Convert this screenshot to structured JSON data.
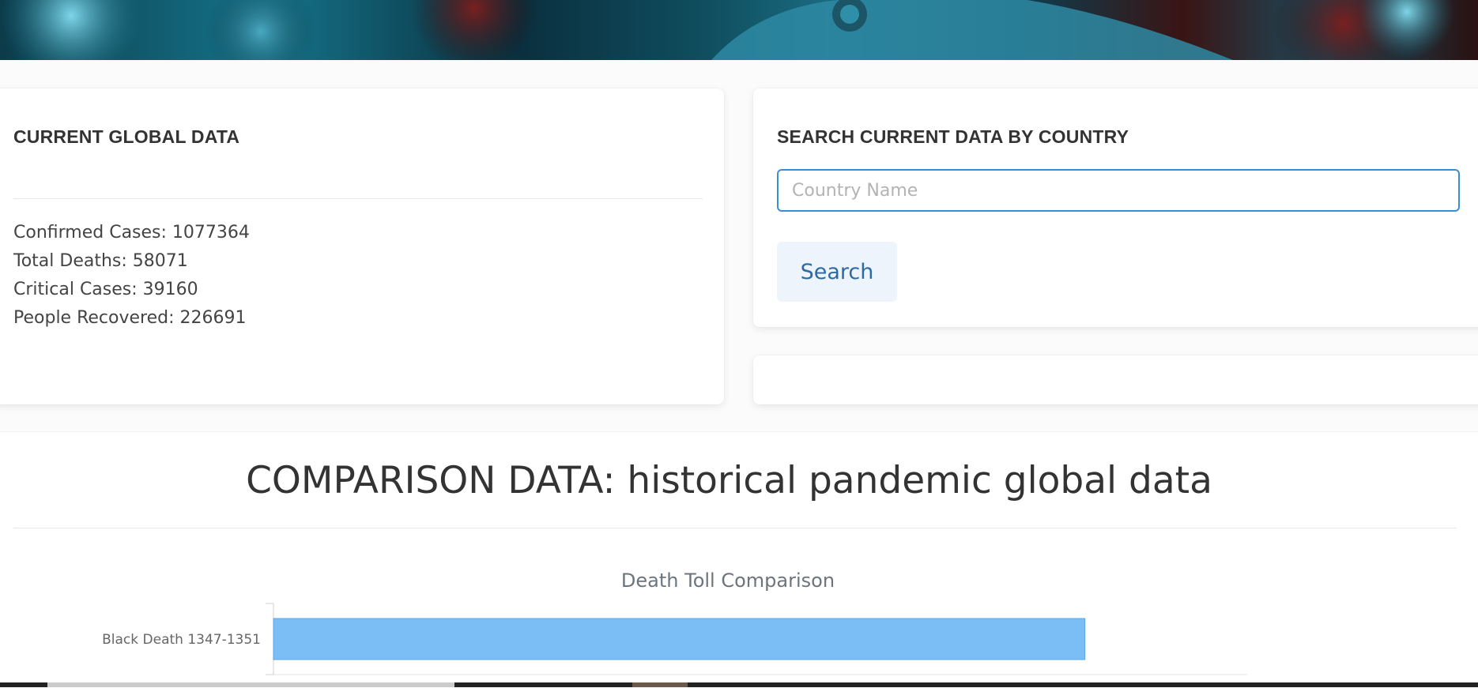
{
  "global": {
    "title": "CURRENT GLOBAL DATA",
    "stats": [
      {
        "label": "Confirmed Cases: ",
        "value": "1077364"
      },
      {
        "label": "Total Deaths: ",
        "value": "58071"
      },
      {
        "label": "Critical Cases: ",
        "value": "39160"
      },
      {
        "label": "People Recovered: ",
        "value": "226691"
      }
    ]
  },
  "search": {
    "title": "SEARCH CURRENT DATA BY COUNTRY",
    "placeholder": "Country Name",
    "value": "",
    "button_label": "Search"
  },
  "comparison": {
    "title": "COMPARISON DATA: historical pandemic global data"
  },
  "colors": {
    "bar_fill": "#7bbef5",
    "bar_border": "#5aa6ea",
    "input_border": "#3b8fd1",
    "button_bg": "#eef4fb",
    "button_text": "#2c6aa6"
  },
  "chart_data": {
    "type": "bar",
    "orientation": "horizontal",
    "title": "Death Toll Comparison",
    "categories": [
      "Black Death 1347-1351"
    ],
    "series": [
      {
        "values": [
          200000000
        ]
      }
    ],
    "xlabel": "",
    "ylabel": "",
    "grid": false
  }
}
